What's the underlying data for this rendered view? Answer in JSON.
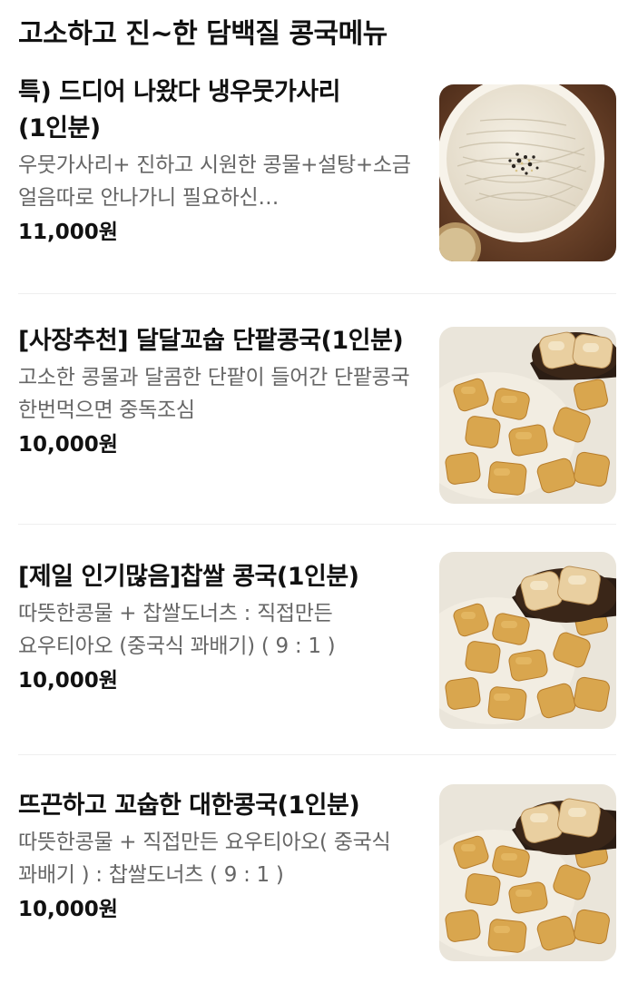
{
  "section": {
    "title": "고소하고 진~한 담백질 콩국메뉴"
  },
  "items": [
    {
      "name": "특) 드디어 나왔다 냉우뭇가사리(1인분)",
      "description": "우뭇가사리+ 진하고 시원한 콩물+설탕+소금 얼음따로 안나가니 필요하신…",
      "price": "11,000원",
      "image": "bowl-of-cold-agar-noodle-soy-milk-soup"
    },
    {
      "name": "[사장추천] 달달꼬숩 단팥콩국(1인분)",
      "description": "고소한 콩물과 달콤한 단팥이 들어간 단팥콩국 한번먹으면 중독조심",
      "price": "10,000원",
      "image": "soy-milk-soup-with-fried-dough-pieces"
    },
    {
      "name": "[제일 인기많음]찹쌀 콩국(1인분)",
      "description": "따뜻한콩물 + 찹쌀도너츠 : 직접만든 요우티아오 (중국식 꽈배기) ( 9 : 1 )",
      "price": "10,000원",
      "image": "soy-milk-soup-with-fried-dough-pieces"
    },
    {
      "name": "뜨끈하고 꼬숩한 대한콩국(1인분)",
      "description": "따뜻한콩물 + 직접만든 요우티아오( 중국식 꽈배기 ) : 찹쌀도너츠 ( 9 : 1 )",
      "price": "10,000원",
      "image": "soy-milk-soup-with-fried-dough-pieces"
    }
  ]
}
